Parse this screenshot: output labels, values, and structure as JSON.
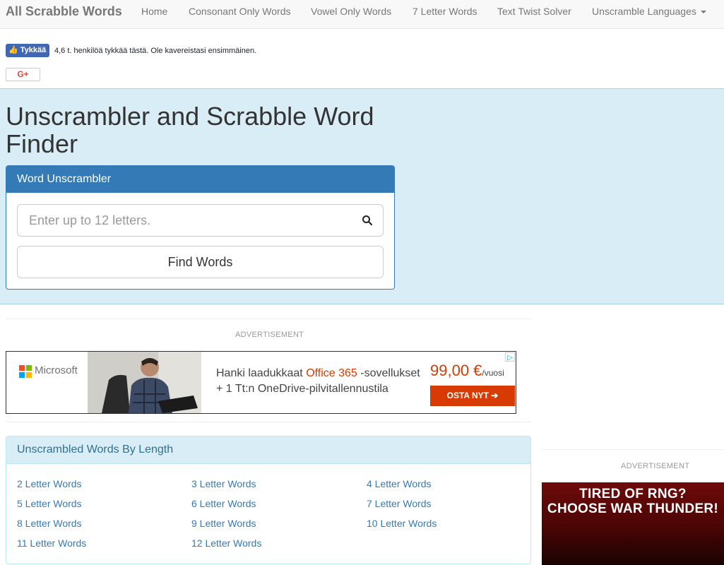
{
  "navbar": {
    "brand": "All Scrabble Words",
    "items": [
      {
        "label": "Home"
      },
      {
        "label": "Consonant Only Words"
      },
      {
        "label": "Vowel Only Words"
      },
      {
        "label": "7 Letter Words"
      },
      {
        "label": "Text Twist Solver"
      },
      {
        "label": "Unscramble Languages"
      }
    ]
  },
  "social": {
    "like_label": "Tykkää",
    "like_text": "4,6 t. henkilöä tykkää tästä. Ole kavereistasi ensimmäinen.",
    "gplus_label": "G+"
  },
  "main": {
    "title": "Unscrambler and Scrabble Word Finder",
    "panel_title": "Word Unscrambler",
    "search_placeholder": "Enter up to 12 letters.",
    "find_button": "Find Words"
  },
  "ads": {
    "label": "ADVERTISEMENT",
    "microsoft": {
      "brand": "Microsoft",
      "line1_prefix": "Hanki laadukkaat ",
      "line1_highlight": "Office 365",
      "line1_suffix": " -sovellukset",
      "line2": "+ 1 Tt:n OneDrive-pilvitallennustila",
      "price": "99,00 €",
      "price_unit": "/vuosi",
      "cta": "OSTA NYT  ➔",
      "colors": {
        "accent": "#d83b01"
      }
    },
    "side": {
      "line1": "TIRED OF RNG?",
      "line2": "CHOOSE WAR THUNDER!"
    }
  },
  "by_length": {
    "title": "Unscrambled Words By Length",
    "links": [
      "2 Letter Words",
      "3 Letter Words",
      "4 Letter Words",
      "5 Letter Words",
      "6 Letter Words",
      "7 Letter Words",
      "8 Letter Words",
      "9 Letter Words",
      "10 Letter Words",
      "11 Letter Words",
      "12 Letter Words"
    ]
  },
  "colors": {
    "primary": "#337ab7",
    "jumbotron": "#d9edf7",
    "link": "#337ab7"
  }
}
